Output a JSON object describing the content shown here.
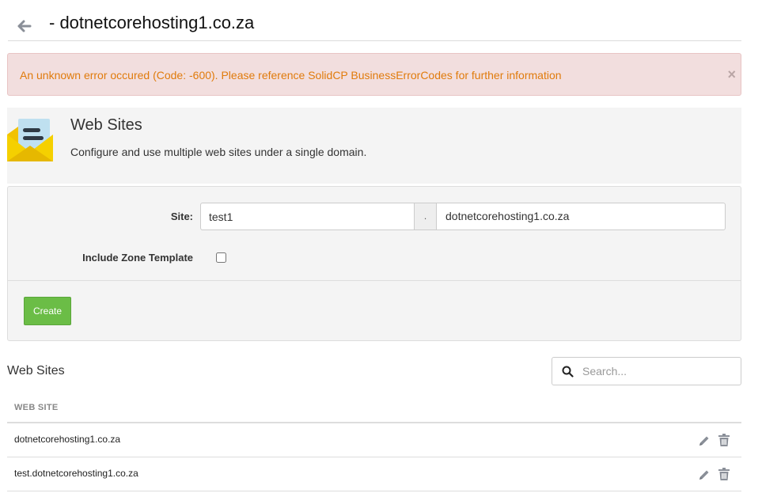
{
  "header": {
    "title": "- dotnetcorehosting1.co.za",
    "back_icon": "arrow-left-icon"
  },
  "alert": {
    "message": "An unknown error occured (Code: -600). Please reference SolidCP BusinessErrorCodes for further information",
    "close": "×"
  },
  "intro": {
    "icon": "web-sites-envelope-icon",
    "title": "Web Sites",
    "description": "Configure and use multiple web sites under a single domain."
  },
  "form": {
    "site_label": "Site:",
    "site_value": "test1",
    "separator": ".",
    "domain": "dotnetcorehosting1.co.za",
    "zone_template_label": "Include Zone Template",
    "zone_template_checked": false,
    "create_label": "Create"
  },
  "list": {
    "title": "Web Sites",
    "search_placeholder": "Search...",
    "column_header": "WEB SITE",
    "rows": [
      {
        "name": "dotnetcorehosting1.co.za"
      },
      {
        "name": "test.dotnetcorehosting1.co.za"
      }
    ]
  },
  "colors": {
    "alert_bg": "#f2dede",
    "alert_text": "#e07b0c",
    "create_button": "#6bbd46",
    "panel_bg": "#f4f4f4"
  }
}
